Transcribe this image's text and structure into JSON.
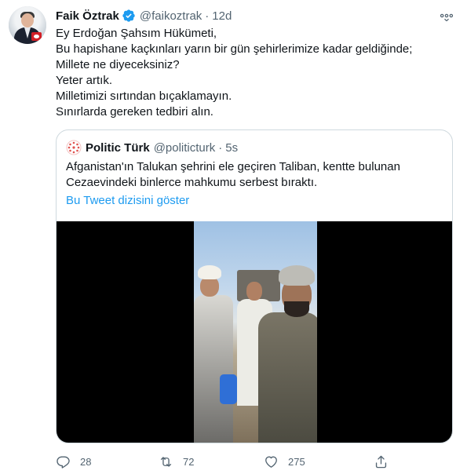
{
  "tweet": {
    "author_name": "Faik Öztrak",
    "author_handle": "@faikoztrak",
    "separator": "·",
    "time": "12d",
    "text": "Ey Erdoğan Şahsım Hükümeti,\nBu hapishane kaçkınları yarın bir gün şehirlerimize kadar geldiğinde;\nMillete ne diyeceksiniz?\nYeter artık.\nMilletimizi sırtından bıçaklamayın.\nSınırlarda gereken tedbiri alın."
  },
  "quoted_tweet": {
    "author_name": "Politic Türk",
    "author_handle": "@politicturk",
    "separator": "·",
    "time": "5s",
    "text": "Afganistan'ın Talukan şehrini ele geçiren Taliban, kentte bulunan\nCezaevindeki binlerce mahkumu serbest bıraktı.",
    "show_thread_label": "Bu Tweet dizisini göster"
  },
  "actions": {
    "reply_count": "28",
    "retweet_count": "72",
    "like_count": "275",
    "share_count": ""
  },
  "icons": {
    "verified": "verified-badge-icon",
    "more": "more-icon",
    "reply": "reply-icon",
    "retweet": "retweet-icon",
    "like": "heart-icon",
    "share": "share-icon"
  },
  "colors": {
    "accent": "#1d9bf0",
    "secondary_text": "#536471",
    "border": "#cfd9de"
  }
}
